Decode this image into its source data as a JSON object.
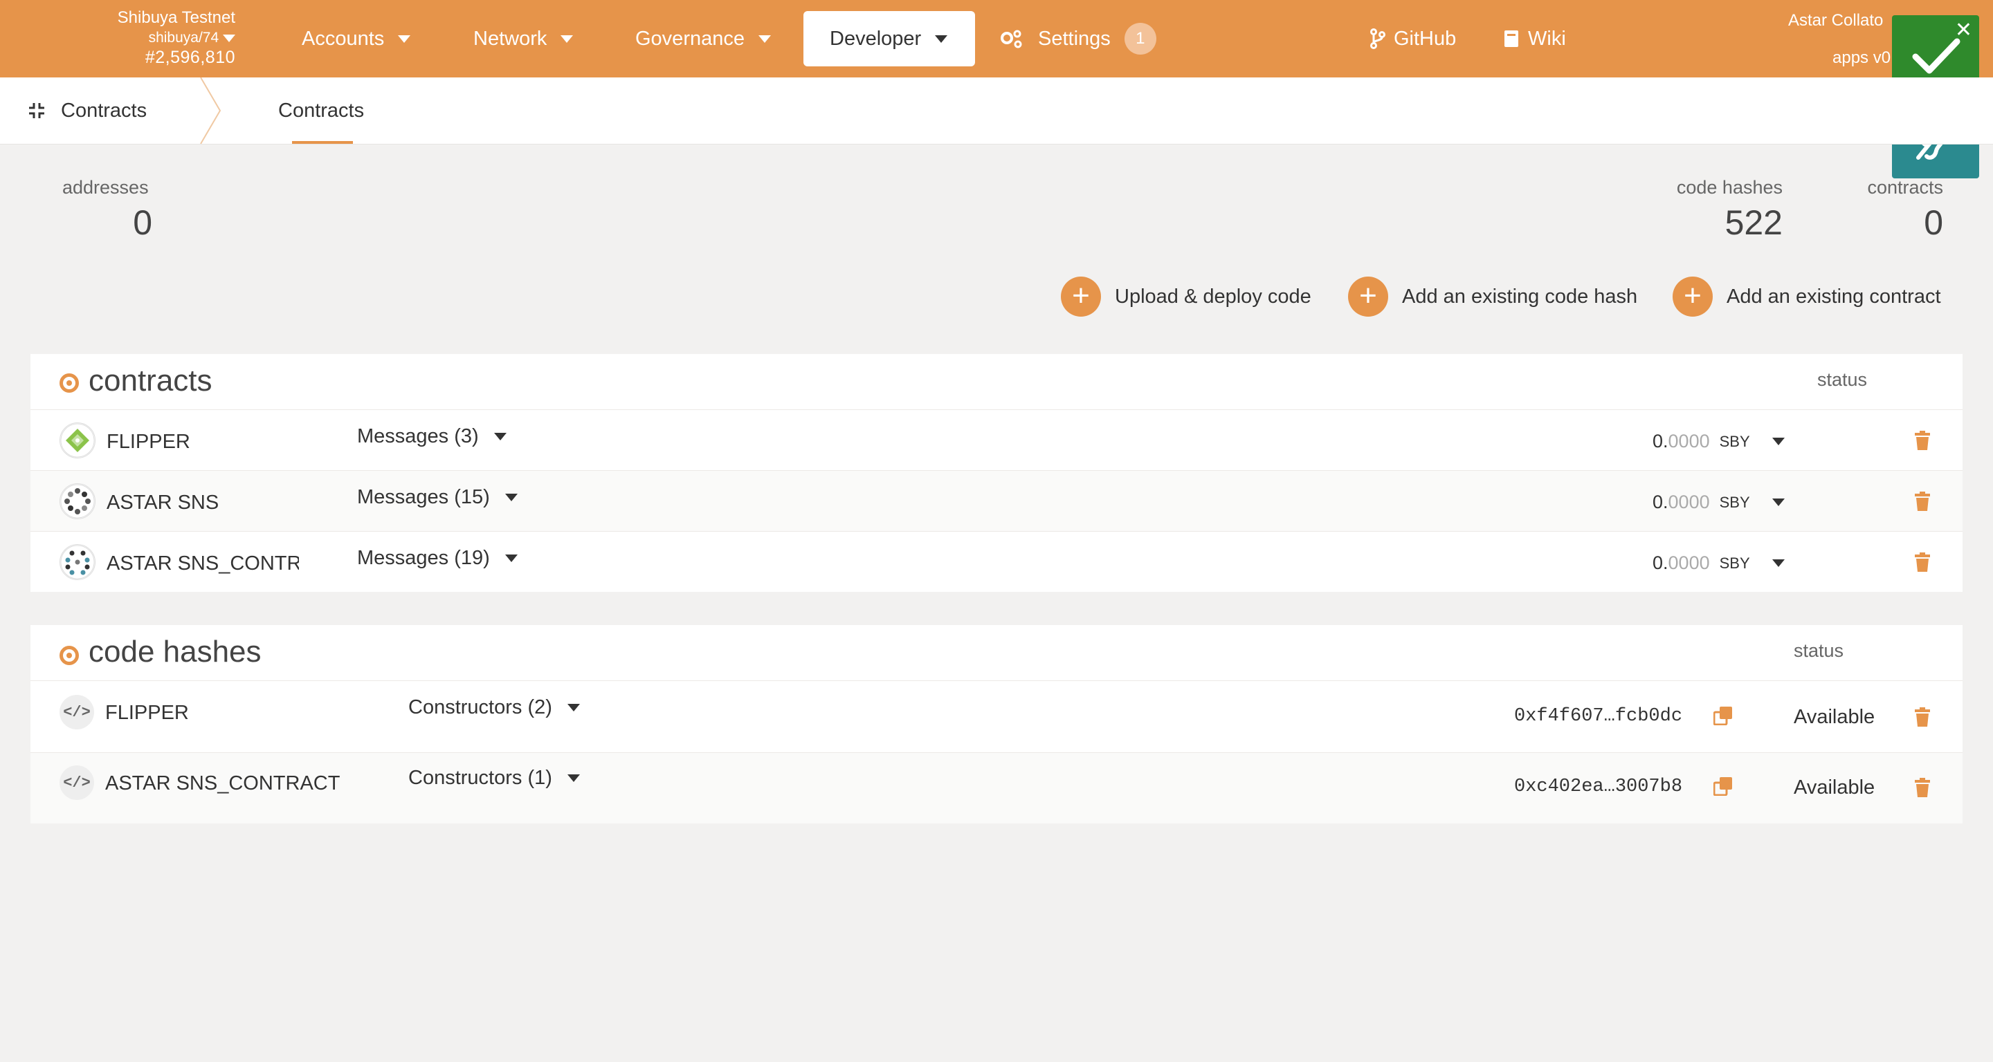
{
  "topbar": {
    "chain_name": "Shibuya Testnet",
    "chain_spec": "shibuya/74",
    "block_number": "#2,596,810",
    "nav": [
      {
        "label": "Accounts"
      },
      {
        "label": "Network"
      },
      {
        "label": "Governance"
      },
      {
        "label": "Developer"
      },
      {
        "label": "Settings",
        "badge": "1"
      }
    ],
    "links": [
      {
        "label": "GitHub"
      },
      {
        "label": "Wiki"
      }
    ],
    "right_title": "Astar Collato",
    "right_version": "apps v0"
  },
  "breadcrumb": {
    "section": "Contracts",
    "tab": "Contracts"
  },
  "summary": {
    "addresses_label": "addresses",
    "addresses_value": "0",
    "code_hashes_label": "code hashes",
    "code_hashes_value": "522",
    "contracts_label": "contracts",
    "contracts_value": "0"
  },
  "actions": {
    "upload": "Upload & deploy code",
    "add_code_hash": "Add an existing code hash",
    "add_contract": "Add an existing contract"
  },
  "contracts": {
    "title": "contracts",
    "status_header": "status",
    "rows": [
      {
        "name": "FLIPPER",
        "messages": "Messages (3)",
        "bal_int": "0.",
        "bal_dec": "0000",
        "unit": "SBY"
      },
      {
        "name": "ASTAR SNS",
        "messages": "Messages (15)",
        "bal_int": "0.",
        "bal_dec": "0000",
        "unit": "SBY"
      },
      {
        "name": "ASTAR SNS_CONTRA",
        "messages": "Messages (19)",
        "bal_int": "0.",
        "bal_dec": "0000",
        "unit": "SBY"
      }
    ]
  },
  "code_hashes": {
    "title": "code hashes",
    "status_header": "status",
    "rows": [
      {
        "name": "FLIPPER",
        "constructors": "Constructors (2)",
        "hash": "0xf4f607…fcb0dc",
        "status": "Available"
      },
      {
        "name": "ASTAR SNS_CONTRACT",
        "constructors": "Constructors (1)",
        "hash": "0xc402ea…3007b8",
        "status": "Available"
      }
    ]
  },
  "colors": {
    "accent": "#e6944a",
    "success": "#2f8a2c",
    "teal": "#2b8a8f"
  }
}
